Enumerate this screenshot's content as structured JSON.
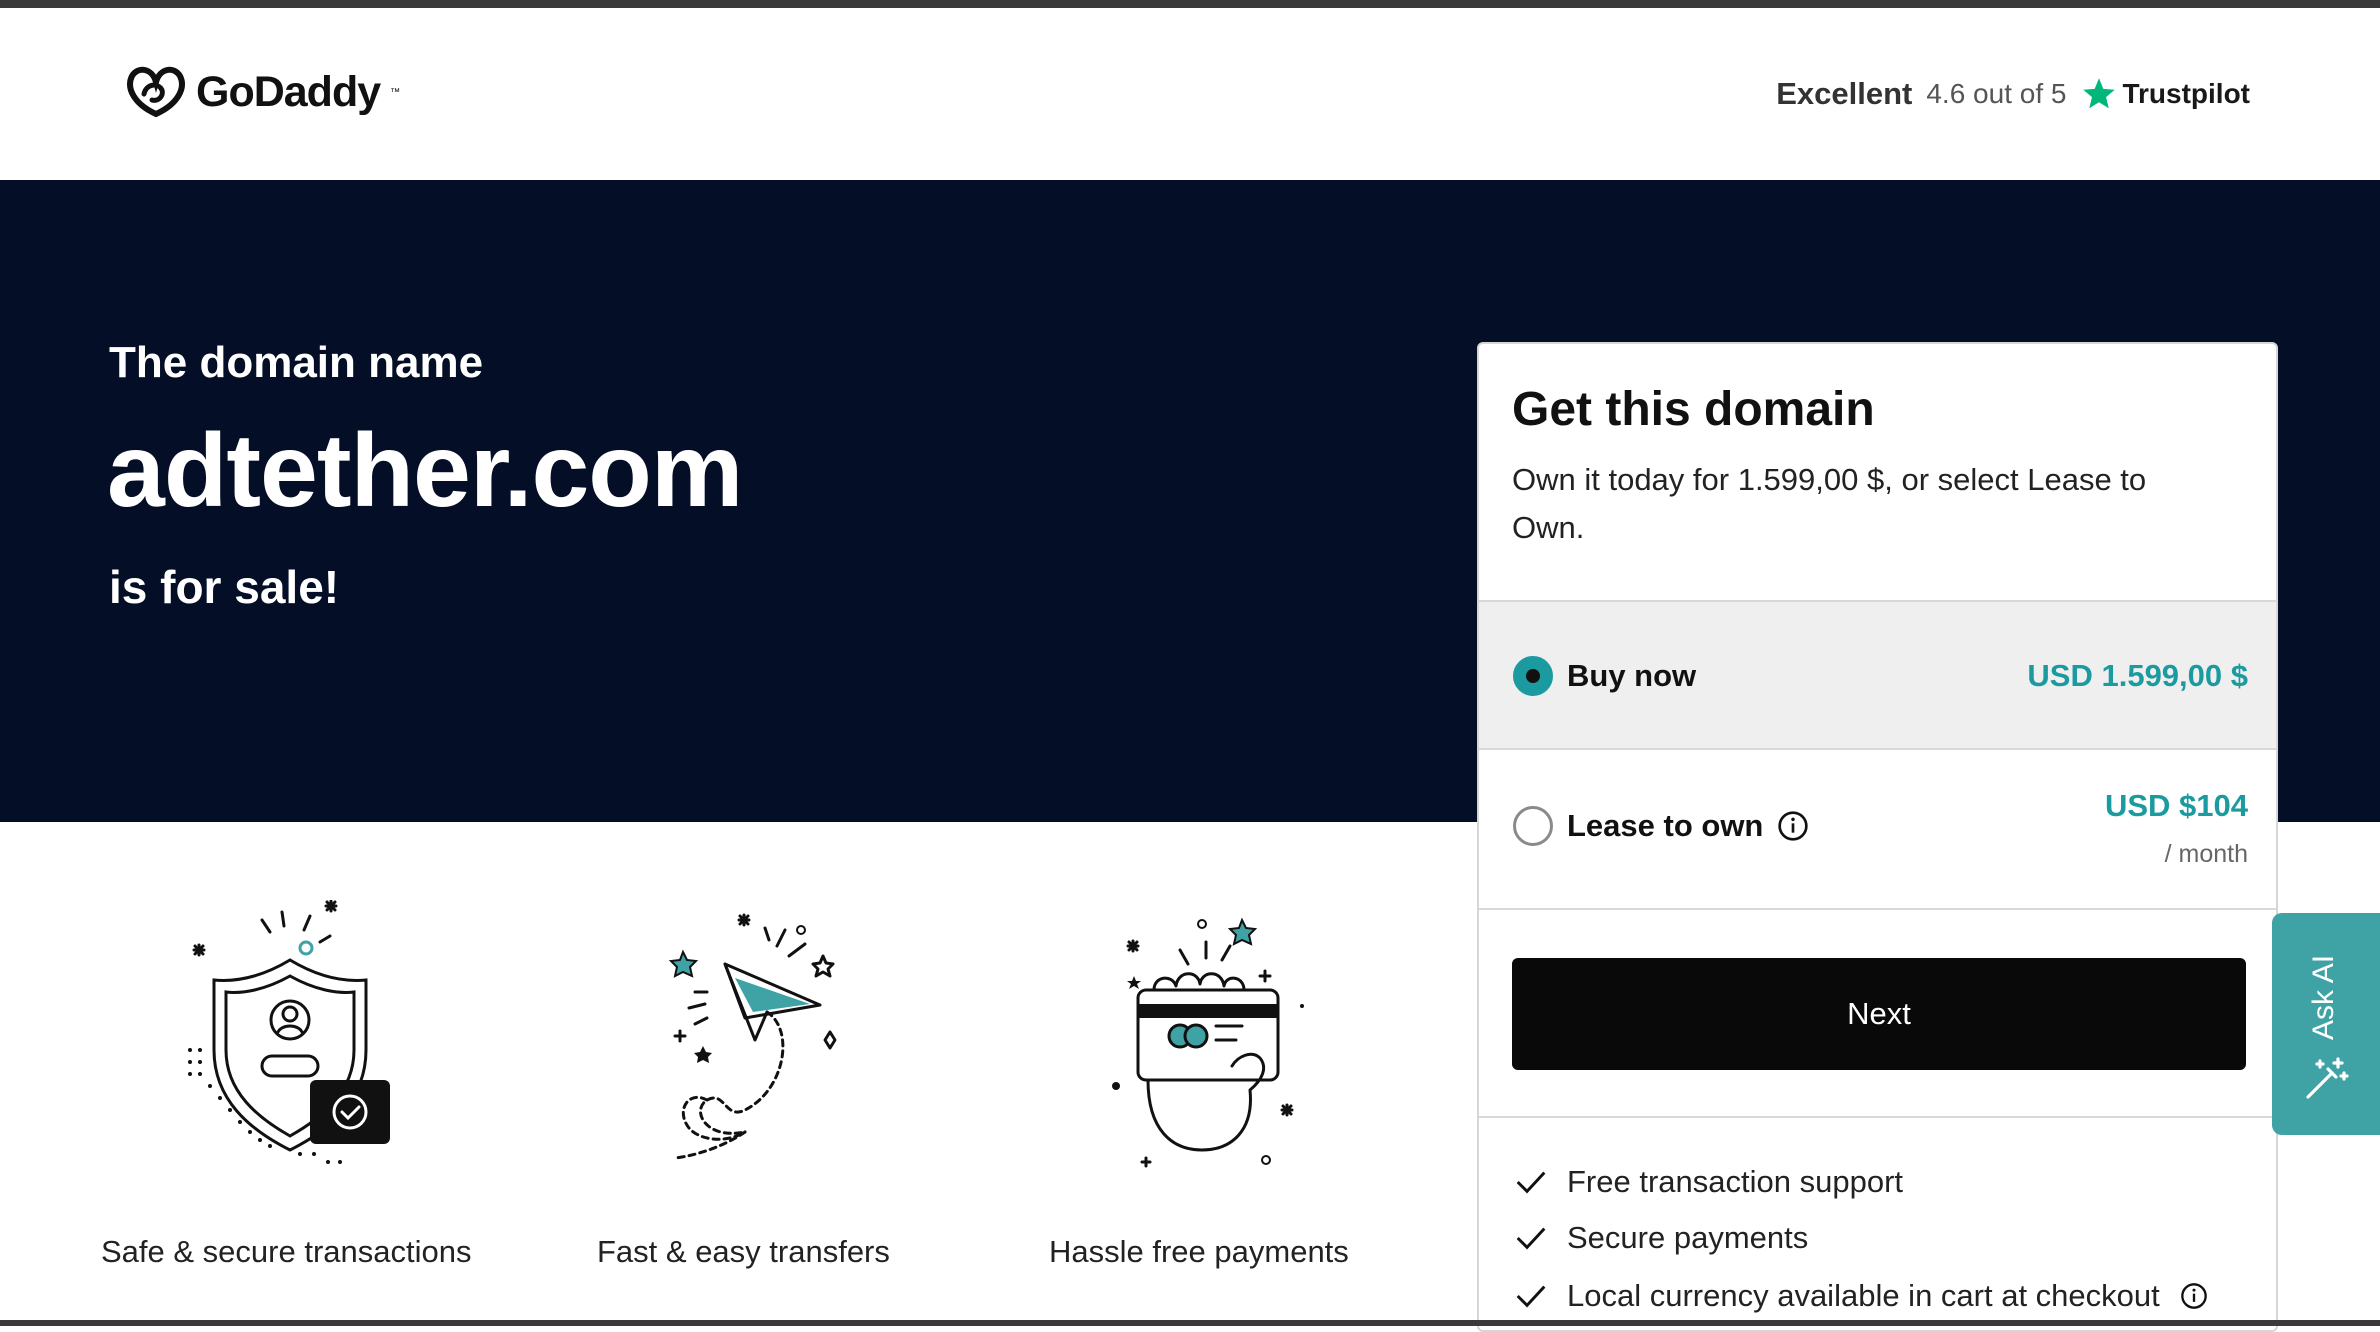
{
  "header": {
    "logo_text": "GoDaddy",
    "trustpilot": {
      "rating_word": "Excellent",
      "score": "4.6 out of 5",
      "brand": "Trustpilot"
    }
  },
  "hero": {
    "subtitle": "The domain name",
    "domain": "adtether.com",
    "tagline": "is for sale!"
  },
  "features": [
    {
      "label": "Safe & secure transactions",
      "icon": "shield-check-icon"
    },
    {
      "label": "Fast & easy transfers",
      "icon": "paper-plane-icon"
    },
    {
      "label": "Hassle free payments",
      "icon": "hand-card-icon"
    }
  ],
  "card": {
    "title": "Get this domain",
    "description": "Own it today for 1.599,00 $, or select Lease to Own.",
    "options": {
      "buy": {
        "label": "Buy now",
        "price": "USD 1.599,00 $",
        "selected": true
      },
      "lease": {
        "label": "Lease to own",
        "price": "USD $104",
        "per": "/ month",
        "selected": false
      }
    },
    "next_label": "Next",
    "bullets": [
      "Free transaction support",
      "Secure payments",
      "Local currency available in cart at checkout"
    ]
  },
  "ask_ai": {
    "label": "Ask AI"
  },
  "colors": {
    "hero_bg": "#040f27",
    "accent_teal": "#1b9aa0",
    "ask_ai_bg": "#3fa3a6",
    "button_bg": "#090909",
    "trustpilot_star": "#00b67a"
  }
}
